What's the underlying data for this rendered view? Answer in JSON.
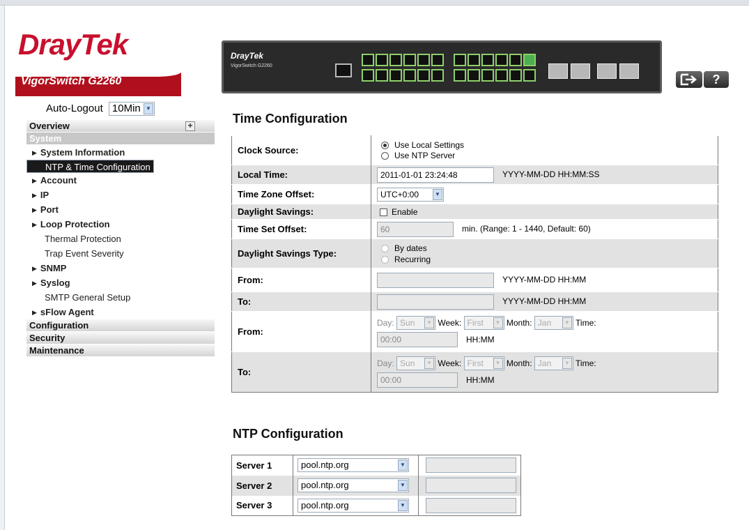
{
  "brand": {
    "logo_dray": "Dray",
    "logo_tek": "Tek",
    "model": "VigorSwitch G2260",
    "device_brand": "DrayTek",
    "device_model": "VigorSwitch G2260"
  },
  "header": {
    "logout_icon": "logout-icon",
    "help_label": "?"
  },
  "autologout": {
    "label": "Auto-Logout",
    "value": "10Min"
  },
  "sidebar": {
    "overview": "Overview",
    "system": "System",
    "items": [
      {
        "label": "System Information",
        "bold": true
      },
      {
        "label": "NTP & Time Configuration",
        "selected": true
      },
      {
        "label": "Account",
        "bold": true
      },
      {
        "label": "IP",
        "bold": true
      },
      {
        "label": "Port",
        "bold": true
      },
      {
        "label": "Loop Protection",
        "bold": true
      },
      {
        "label": "Thermal Protection"
      },
      {
        "label": "Trap Event Severity"
      },
      {
        "label": "SNMP",
        "bold": true
      },
      {
        "label": "Syslog",
        "bold": true
      },
      {
        "label": "SMTP General Setup"
      },
      {
        "label": "sFlow Agent",
        "bold": true
      }
    ],
    "configuration": "Configuration",
    "security": "Security",
    "maintenance": "Maintenance"
  },
  "time": {
    "title": "Time Configuration",
    "clock_source_label": "Clock Source:",
    "opt_local": "Use Local Settings",
    "opt_ntp": "Use NTP Server",
    "local_time_label": "Local Time:",
    "local_time_value": "2011-01-01 23:24:48",
    "local_time_hint": "YYYY-MM-DD HH:MM:SS",
    "tz_label": "Time Zone Offset:",
    "tz_value": "UTC+0:00",
    "dst_label": "Daylight Savings:",
    "dst_enable": "Enable",
    "offset_label": "Time Set Offset:",
    "offset_value": "60",
    "offset_hint": "min. (Range: 1 - 1440, Default: 60)",
    "dst_type_label": "Daylight Savings Type:",
    "by_dates": "By dates",
    "recurring": "Recurring",
    "from_label": "From:",
    "to_label": "To:",
    "date_hint": "YYYY-MM-DD HH:MM",
    "day_label": "Day:",
    "day_value": "Sun",
    "week_label": "Week:",
    "week_value": "First",
    "month_label": "Month:",
    "month_value": "Jan",
    "time_label": "Time:",
    "time_value": "00:00",
    "time_hint": "HH:MM"
  },
  "ntp": {
    "title": "NTP Configuration",
    "servers": [
      {
        "label": "Server 1",
        "value": "pool.ntp.org"
      },
      {
        "label": "Server 2",
        "value": "pool.ntp.org"
      },
      {
        "label": "Server 3",
        "value": "pool.ntp.org"
      }
    ]
  }
}
